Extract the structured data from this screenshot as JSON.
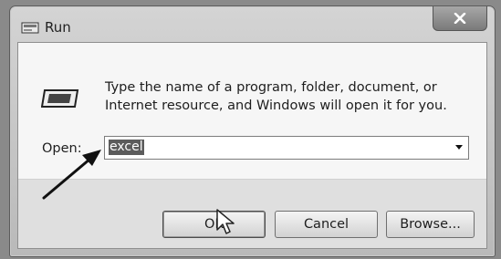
{
  "window": {
    "title": "Run",
    "close_glyph": "x",
    "icon": "run-app-icon"
  },
  "dialog": {
    "icon": "run-icon",
    "message": "Type the name of a program, folder, document, or Internet resource, and Windows will open it for you.",
    "open_label": "Open:",
    "open_value": "excel"
  },
  "buttons": {
    "ok": "OK",
    "cancel": "Cancel",
    "browse": "Browse..."
  },
  "annotation": {
    "arrow": "pointer-arrow",
    "cursor": "mouse-cursor-icon"
  }
}
